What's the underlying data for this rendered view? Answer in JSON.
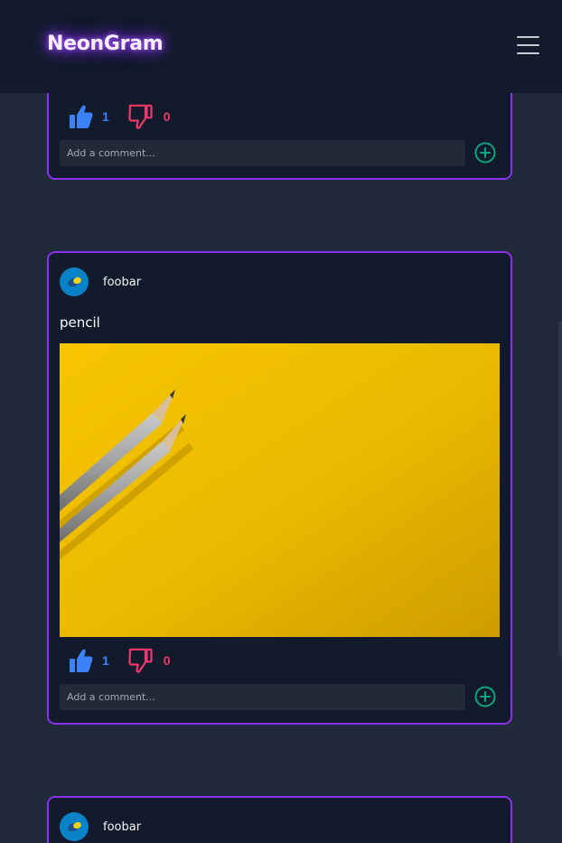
{
  "app": {
    "title": "NeonGram"
  },
  "colors": {
    "accent": "#8b31f0",
    "background": "#212a3a",
    "card": "#131a2b",
    "like": "#3b82f6",
    "dislike": "#f0386b",
    "add_comment": "#10a37f"
  },
  "header": {
    "menu_icon": "hamburger-menu-icon"
  },
  "posts": [
    {
      "author": "",
      "caption": "",
      "likes": "1",
      "dislikes": "0",
      "comment_placeholder": "Add a comment..."
    },
    {
      "author": "foobar",
      "caption": "pencil",
      "image": "two-pencils-on-yellow-background",
      "likes": "1",
      "dislikes": "0",
      "comment_placeholder": "Add a comment..."
    },
    {
      "author": "foobar"
    }
  ]
}
